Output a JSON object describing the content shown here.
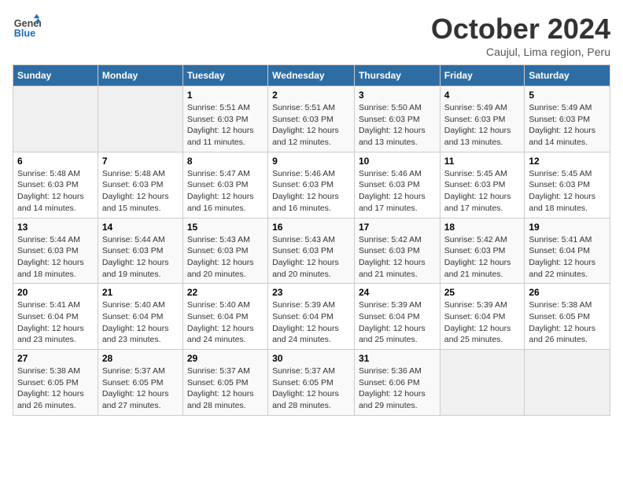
{
  "logo": {
    "general": "General",
    "blue": "Blue"
  },
  "title": "October 2024",
  "subtitle": "Caujul, Lima region, Peru",
  "headers": [
    "Sunday",
    "Monday",
    "Tuesday",
    "Wednesday",
    "Thursday",
    "Friday",
    "Saturday"
  ],
  "weeks": [
    [
      {
        "day": "",
        "sunrise": "",
        "sunset": "",
        "daylight": ""
      },
      {
        "day": "",
        "sunrise": "",
        "sunset": "",
        "daylight": ""
      },
      {
        "day": "1",
        "sunrise": "Sunrise: 5:51 AM",
        "sunset": "Sunset: 6:03 PM",
        "daylight": "Daylight: 12 hours and 11 minutes."
      },
      {
        "day": "2",
        "sunrise": "Sunrise: 5:51 AM",
        "sunset": "Sunset: 6:03 PM",
        "daylight": "Daylight: 12 hours and 12 minutes."
      },
      {
        "day": "3",
        "sunrise": "Sunrise: 5:50 AM",
        "sunset": "Sunset: 6:03 PM",
        "daylight": "Daylight: 12 hours and 13 minutes."
      },
      {
        "day": "4",
        "sunrise": "Sunrise: 5:49 AM",
        "sunset": "Sunset: 6:03 PM",
        "daylight": "Daylight: 12 hours and 13 minutes."
      },
      {
        "day": "5",
        "sunrise": "Sunrise: 5:49 AM",
        "sunset": "Sunset: 6:03 PM",
        "daylight": "Daylight: 12 hours and 14 minutes."
      }
    ],
    [
      {
        "day": "6",
        "sunrise": "Sunrise: 5:48 AM",
        "sunset": "Sunset: 6:03 PM",
        "daylight": "Daylight: 12 hours and 14 minutes."
      },
      {
        "day": "7",
        "sunrise": "Sunrise: 5:48 AM",
        "sunset": "Sunset: 6:03 PM",
        "daylight": "Daylight: 12 hours and 15 minutes."
      },
      {
        "day": "8",
        "sunrise": "Sunrise: 5:47 AM",
        "sunset": "Sunset: 6:03 PM",
        "daylight": "Daylight: 12 hours and 16 minutes."
      },
      {
        "day": "9",
        "sunrise": "Sunrise: 5:46 AM",
        "sunset": "Sunset: 6:03 PM",
        "daylight": "Daylight: 12 hours and 16 minutes."
      },
      {
        "day": "10",
        "sunrise": "Sunrise: 5:46 AM",
        "sunset": "Sunset: 6:03 PM",
        "daylight": "Daylight: 12 hours and 17 minutes."
      },
      {
        "day": "11",
        "sunrise": "Sunrise: 5:45 AM",
        "sunset": "Sunset: 6:03 PM",
        "daylight": "Daylight: 12 hours and 17 minutes."
      },
      {
        "day": "12",
        "sunrise": "Sunrise: 5:45 AM",
        "sunset": "Sunset: 6:03 PM",
        "daylight": "Daylight: 12 hours and 18 minutes."
      }
    ],
    [
      {
        "day": "13",
        "sunrise": "Sunrise: 5:44 AM",
        "sunset": "Sunset: 6:03 PM",
        "daylight": "Daylight: 12 hours and 18 minutes."
      },
      {
        "day": "14",
        "sunrise": "Sunrise: 5:44 AM",
        "sunset": "Sunset: 6:03 PM",
        "daylight": "Daylight: 12 hours and 19 minutes."
      },
      {
        "day": "15",
        "sunrise": "Sunrise: 5:43 AM",
        "sunset": "Sunset: 6:03 PM",
        "daylight": "Daylight: 12 hours and 20 minutes."
      },
      {
        "day": "16",
        "sunrise": "Sunrise: 5:43 AM",
        "sunset": "Sunset: 6:03 PM",
        "daylight": "Daylight: 12 hours and 20 minutes."
      },
      {
        "day": "17",
        "sunrise": "Sunrise: 5:42 AM",
        "sunset": "Sunset: 6:03 PM",
        "daylight": "Daylight: 12 hours and 21 minutes."
      },
      {
        "day": "18",
        "sunrise": "Sunrise: 5:42 AM",
        "sunset": "Sunset: 6:03 PM",
        "daylight": "Daylight: 12 hours and 21 minutes."
      },
      {
        "day": "19",
        "sunrise": "Sunrise: 5:41 AM",
        "sunset": "Sunset: 6:04 PM",
        "daylight": "Daylight: 12 hours and 22 minutes."
      }
    ],
    [
      {
        "day": "20",
        "sunrise": "Sunrise: 5:41 AM",
        "sunset": "Sunset: 6:04 PM",
        "daylight": "Daylight: 12 hours and 23 minutes."
      },
      {
        "day": "21",
        "sunrise": "Sunrise: 5:40 AM",
        "sunset": "Sunset: 6:04 PM",
        "daylight": "Daylight: 12 hours and 23 minutes."
      },
      {
        "day": "22",
        "sunrise": "Sunrise: 5:40 AM",
        "sunset": "Sunset: 6:04 PM",
        "daylight": "Daylight: 12 hours and 24 minutes."
      },
      {
        "day": "23",
        "sunrise": "Sunrise: 5:39 AM",
        "sunset": "Sunset: 6:04 PM",
        "daylight": "Daylight: 12 hours and 24 minutes."
      },
      {
        "day": "24",
        "sunrise": "Sunrise: 5:39 AM",
        "sunset": "Sunset: 6:04 PM",
        "daylight": "Daylight: 12 hours and 25 minutes."
      },
      {
        "day": "25",
        "sunrise": "Sunrise: 5:39 AM",
        "sunset": "Sunset: 6:04 PM",
        "daylight": "Daylight: 12 hours and 25 minutes."
      },
      {
        "day": "26",
        "sunrise": "Sunrise: 5:38 AM",
        "sunset": "Sunset: 6:05 PM",
        "daylight": "Daylight: 12 hours and 26 minutes."
      }
    ],
    [
      {
        "day": "27",
        "sunrise": "Sunrise: 5:38 AM",
        "sunset": "Sunset: 6:05 PM",
        "daylight": "Daylight: 12 hours and 26 minutes."
      },
      {
        "day": "28",
        "sunrise": "Sunrise: 5:37 AM",
        "sunset": "Sunset: 6:05 PM",
        "daylight": "Daylight: 12 hours and 27 minutes."
      },
      {
        "day": "29",
        "sunrise": "Sunrise: 5:37 AM",
        "sunset": "Sunset: 6:05 PM",
        "daylight": "Daylight: 12 hours and 28 minutes."
      },
      {
        "day": "30",
        "sunrise": "Sunrise: 5:37 AM",
        "sunset": "Sunset: 6:05 PM",
        "daylight": "Daylight: 12 hours and 28 minutes."
      },
      {
        "day": "31",
        "sunrise": "Sunrise: 5:36 AM",
        "sunset": "Sunset: 6:06 PM",
        "daylight": "Daylight: 12 hours and 29 minutes."
      },
      {
        "day": "",
        "sunrise": "",
        "sunset": "",
        "daylight": ""
      },
      {
        "day": "",
        "sunrise": "",
        "sunset": "",
        "daylight": ""
      }
    ]
  ]
}
